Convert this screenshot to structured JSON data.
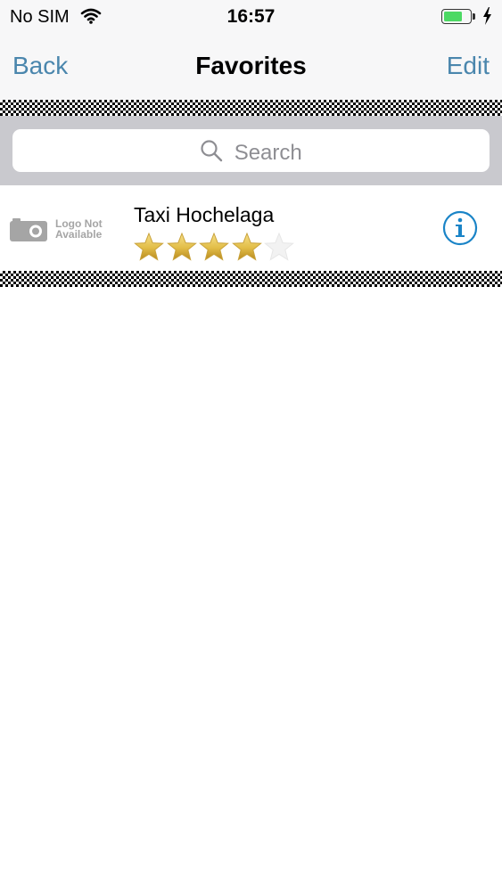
{
  "status_bar": {
    "carrier": "No SIM",
    "time": "16:57",
    "wifi_icon": "wifi-icon",
    "battery_level": 0.75,
    "charging_icon": "bolt-icon"
  },
  "nav": {
    "back_label": "Back",
    "title": "Favorites",
    "edit_label": "Edit",
    "accent_color": "#4a86ad"
  },
  "search": {
    "placeholder": "Search",
    "icon": "search-icon"
  },
  "favorites": [
    {
      "name": "Taxi Hochelaga",
      "logo_text_line1": "Logo Not",
      "logo_text_line2": "Available",
      "rating": 4,
      "max_rating": 5,
      "accessory_icon": "info-icon"
    }
  ]
}
